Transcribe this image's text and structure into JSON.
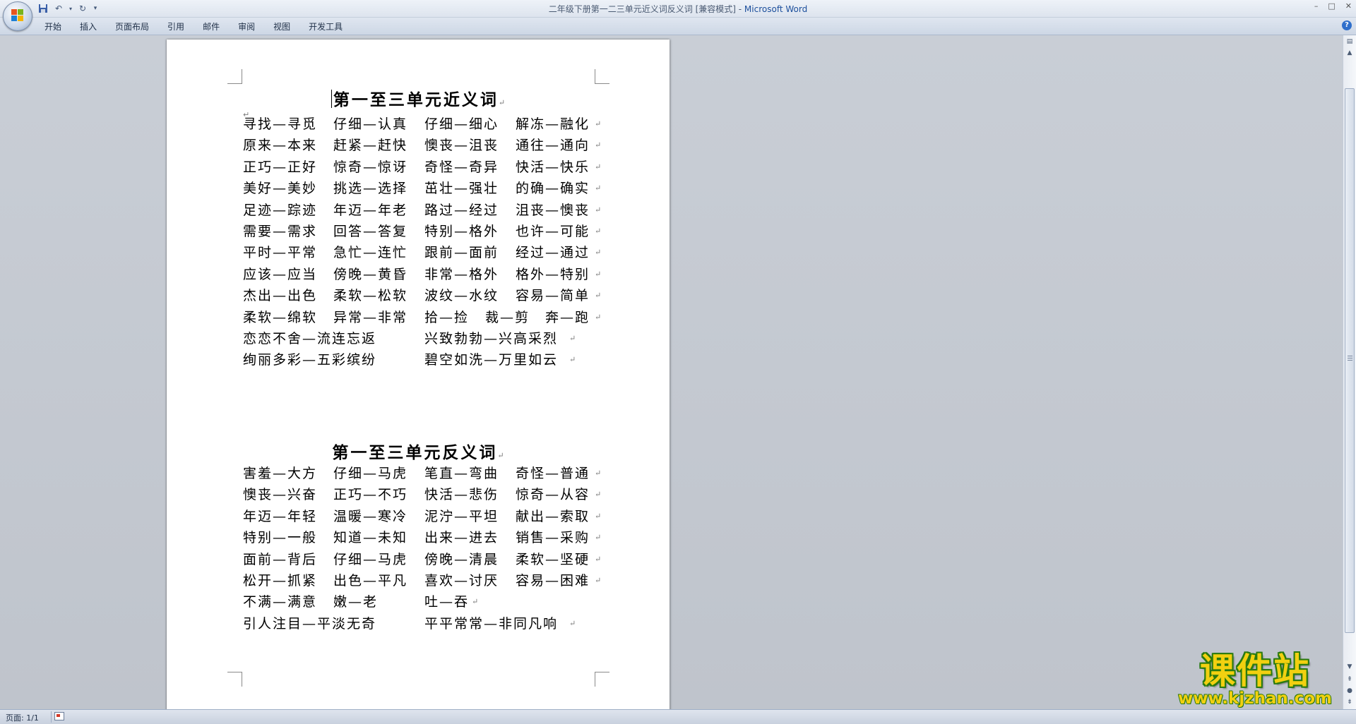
{
  "window": {
    "title_doc": "二年级下册第一二三单元近义词反义词 [兼容模式] - ",
    "title_app": "Microsoft Word",
    "controls": [
      "–",
      "□",
      "✕"
    ]
  },
  "qat": {
    "save": "save-icon",
    "undo": "undo-icon",
    "redo": "redo-icon",
    "more": "▾"
  },
  "ribbon": {
    "tabs": [
      "开始",
      "插入",
      "页面布局",
      "引用",
      "邮件",
      "审阅",
      "视图",
      "开发工具"
    ],
    "help": "?"
  },
  "doc": {
    "para_mark": "↵",
    "heading1": "第一至三单元近义词",
    "synonym_rows": [
      [
        "寻找—寻觅",
        "仔细—认真",
        "仔细—细心",
        "解冻—融化"
      ],
      [
        "原来—本来",
        "赶紧—赶快",
        "懊丧—沮丧",
        "通往—通向"
      ],
      [
        "正巧—正好",
        "惊奇—惊讶",
        "奇怪—奇异",
        "快活—快乐"
      ],
      [
        "美好—美妙",
        "挑选—选择",
        "茁壮—强壮",
        "的确—确实"
      ],
      [
        "足迹—踪迹",
        "年迈—年老",
        "路过—经过",
        "沮丧—懊丧"
      ],
      [
        "需要—需求",
        "回答—答复",
        "特别—格外",
        "也许—可能"
      ],
      [
        "平时—平常",
        "急忙—连忙",
        "跟前—面前",
        "经过—通过"
      ],
      [
        "应该—应当",
        "傍晚—黄昏",
        "非常—格外",
        "格外—特别"
      ],
      [
        "杰出—出色",
        "柔软—松软",
        "波纹—水纹",
        "容易—简单"
      ],
      [
        "柔软—绵软",
        "异常—非常",
        "拾—捡",
        "裁—剪",
        "奔—跑"
      ],
      [
        "恋恋不舍—流连忘返",
        "兴致勃勃—兴高采烈"
      ],
      [
        "绚丽多彩—五彩缤纷",
        "碧空如洗—万里如云"
      ]
    ],
    "heading2": "第一至三单元反义词",
    "antonym_rows": [
      [
        "害羞—大方",
        "仔细—马虎",
        "笔直—弯曲",
        "奇怪—普通"
      ],
      [
        "懊丧—兴奋",
        "正巧—不巧",
        "快活—悲伤",
        "惊奇—从容"
      ],
      [
        "年迈—年轻",
        "温暖—寒冷",
        "泥泞—平坦",
        "献出—索取"
      ],
      [
        "特别—一般",
        "知道—未知",
        "出来—进去",
        "销售—采购"
      ],
      [
        "面前—背后",
        "仔细—马虎",
        "傍晚—清晨",
        "柔软—坚硬"
      ],
      [
        "松开—抓紧",
        "出色—平凡",
        "喜欢—讨厌",
        "容易—困难"
      ],
      [
        "不满—满意",
        "嫩—老",
        "吐—吞"
      ],
      [
        "引人注目—平淡无奇",
        "平平常常—非同凡响"
      ]
    ]
  },
  "status": {
    "page": "页面: 1/1"
  },
  "watermark": {
    "brand": "课件站",
    "url": "www.kjzhan.com"
  },
  "colors": {
    "title_app": "#1c4f9c",
    "workspace": "#c4c9d1",
    "watermark_fill": "#f2d010",
    "watermark_outline": "#2a7a10"
  }
}
